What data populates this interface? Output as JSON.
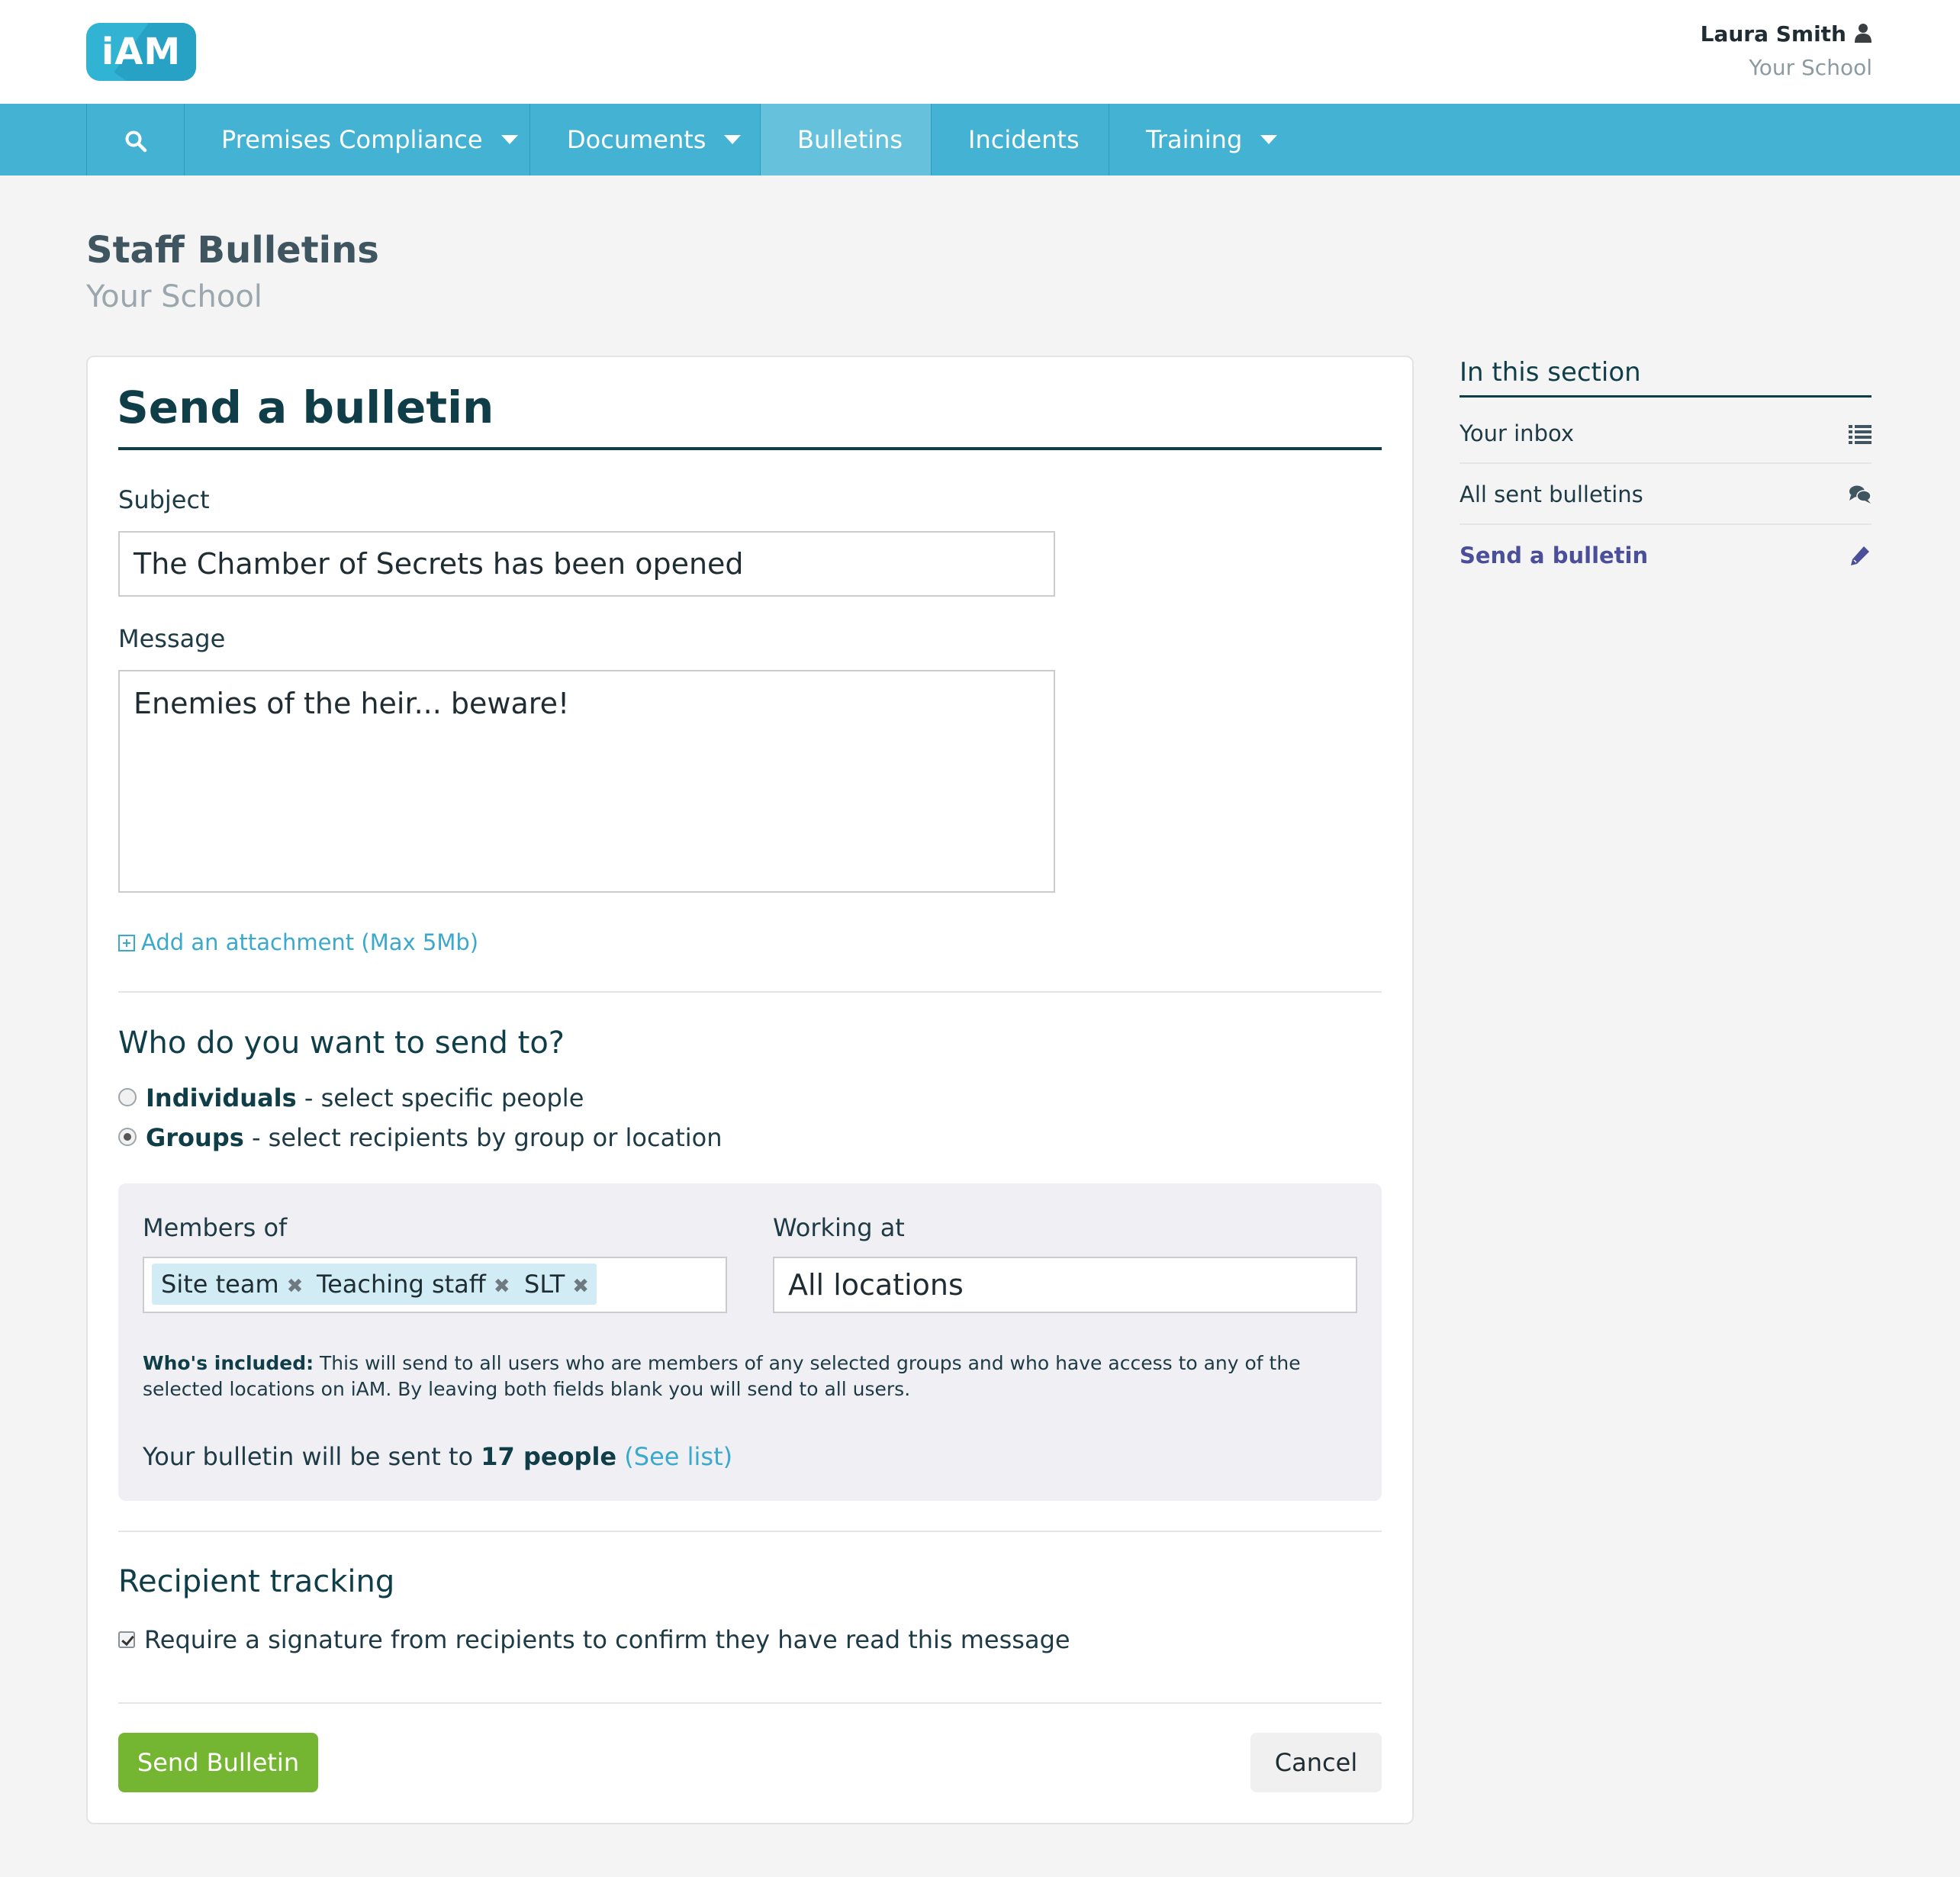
{
  "app": {
    "logo_text": "iAM",
    "user_name": "Laura Smith",
    "user_school": "Your School"
  },
  "nav": {
    "search_icon": "search-icon",
    "items": [
      {
        "label": "Premises Compliance",
        "dropdown": true
      },
      {
        "label": "Documents",
        "dropdown": true
      },
      {
        "label": "Bulletins",
        "active": true
      },
      {
        "label": "Incidents"
      },
      {
        "label": "Training",
        "dropdown": true
      }
    ]
  },
  "page": {
    "title": "Staff Bulletins",
    "subtitle": "Your School"
  },
  "form": {
    "title": "Send a bulletin",
    "subject_label": "Subject",
    "subject_value": "The Chamber of Secrets has been opened",
    "message_label": "Message",
    "message_value": "Enemies of the heir... beware!",
    "attachment_link": "Add an attachment (Max 5Mb)",
    "recipients_heading": "Who do you want to send to?",
    "option_individuals_label": "Individuals",
    "option_individuals_desc": " - select specific people",
    "option_groups_label": "Groups",
    "option_groups_desc": " - select recipients by group or location",
    "selected_option": "Groups",
    "members_label": "Members of",
    "member_tags": [
      "Site team",
      "Teaching staff",
      "SLT"
    ],
    "working_at_label": "Working at",
    "working_at_value": "All locations",
    "included_label": "Who's included:",
    "included_text": " This will send to all users who are members of any selected groups and who have access to any of the selected locations on iAM. By leaving both fields blank you will send to all users.",
    "count_prefix": "Your bulletin will be sent to ",
    "count_value": "17 people",
    "see_list": "(See list)",
    "tracking_heading": "Recipient tracking",
    "tracking_checkbox_label": "Require a signature from recipients to confirm they have read this message",
    "tracking_checked": true,
    "send_button": "Send Bulletin",
    "cancel_button": "Cancel"
  },
  "sidebar": {
    "heading": "In this section",
    "items": [
      {
        "label": "Your inbox",
        "icon": "list-icon"
      },
      {
        "label": "All sent bulletins",
        "icon": "comments-icon"
      },
      {
        "label": "Send a bulletin",
        "icon": "pencil-icon",
        "current": true
      }
    ]
  },
  "colors": {
    "nav_bg": "#43b2d3",
    "nav_active": "#65c1dc",
    "primary_dark": "#0f3e49",
    "link": "#3aa9cb",
    "send_button": "#74b631",
    "tag_bg": "#d1ecf4",
    "sidebar_current": "#4b4f99"
  }
}
